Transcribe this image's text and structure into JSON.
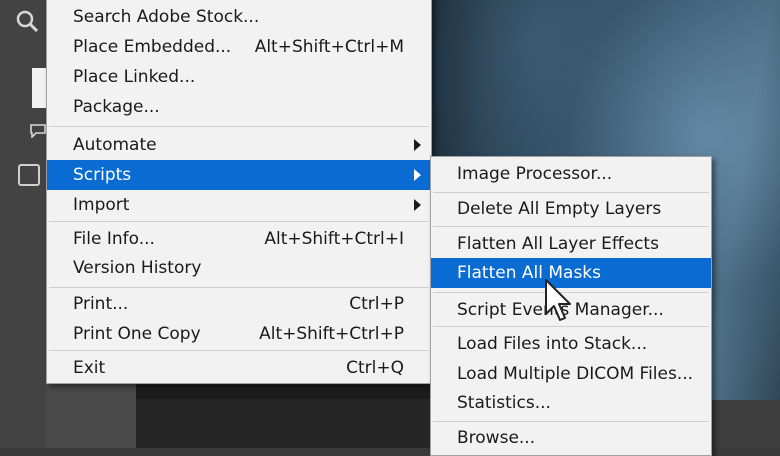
{
  "file_menu": {
    "items": [
      {
        "id": "search-adobe-stock",
        "label": "Search Adobe Stock...",
        "shortcut": ""
      },
      {
        "id": "place-embedded",
        "label": "Place Embedded...",
        "shortcut": "Alt+Shift+Ctrl+M"
      },
      {
        "id": "place-linked",
        "label": "Place Linked...",
        "shortcut": ""
      },
      {
        "id": "package",
        "label": "Package...",
        "shortcut": ""
      },
      {
        "id": "automate",
        "label": "Automate",
        "shortcut": ""
      },
      {
        "id": "scripts",
        "label": "Scripts",
        "shortcut": ""
      },
      {
        "id": "import",
        "label": "Import",
        "shortcut": ""
      },
      {
        "id": "file-info",
        "label": "File Info...",
        "shortcut": "Alt+Shift+Ctrl+I"
      },
      {
        "id": "version-history",
        "label": "Version History",
        "shortcut": ""
      },
      {
        "id": "print",
        "label": "Print...",
        "shortcut": "Ctrl+P"
      },
      {
        "id": "print-one-copy",
        "label": "Print One Copy",
        "shortcut": "Alt+Shift+Ctrl+P"
      },
      {
        "id": "exit",
        "label": "Exit",
        "shortcut": "Ctrl+Q"
      }
    ]
  },
  "scripts_submenu": {
    "items": [
      {
        "id": "image-processor",
        "label": "Image Processor..."
      },
      {
        "id": "delete-all-empty-layers",
        "label": "Delete All Empty Layers"
      },
      {
        "id": "flatten-all-layer-effects",
        "label": "Flatten All Layer Effects"
      },
      {
        "id": "flatten-all-masks",
        "label": "Flatten All Masks"
      },
      {
        "id": "script-events-manager",
        "label": "Script Events Manager..."
      },
      {
        "id": "load-files-into-stack",
        "label": "Load Files into Stack..."
      },
      {
        "id": "load-multiple-dicom-files",
        "label": "Load Multiple DICOM Files..."
      },
      {
        "id": "statistics",
        "label": "Statistics..."
      },
      {
        "id": "browse",
        "label": "Browse..."
      }
    ]
  },
  "colors": {
    "menu_bg": "#f2f2f2",
    "highlight": "#0a6bd2",
    "highlight_text": "#ffffff",
    "text": "#1a1a1a"
  }
}
